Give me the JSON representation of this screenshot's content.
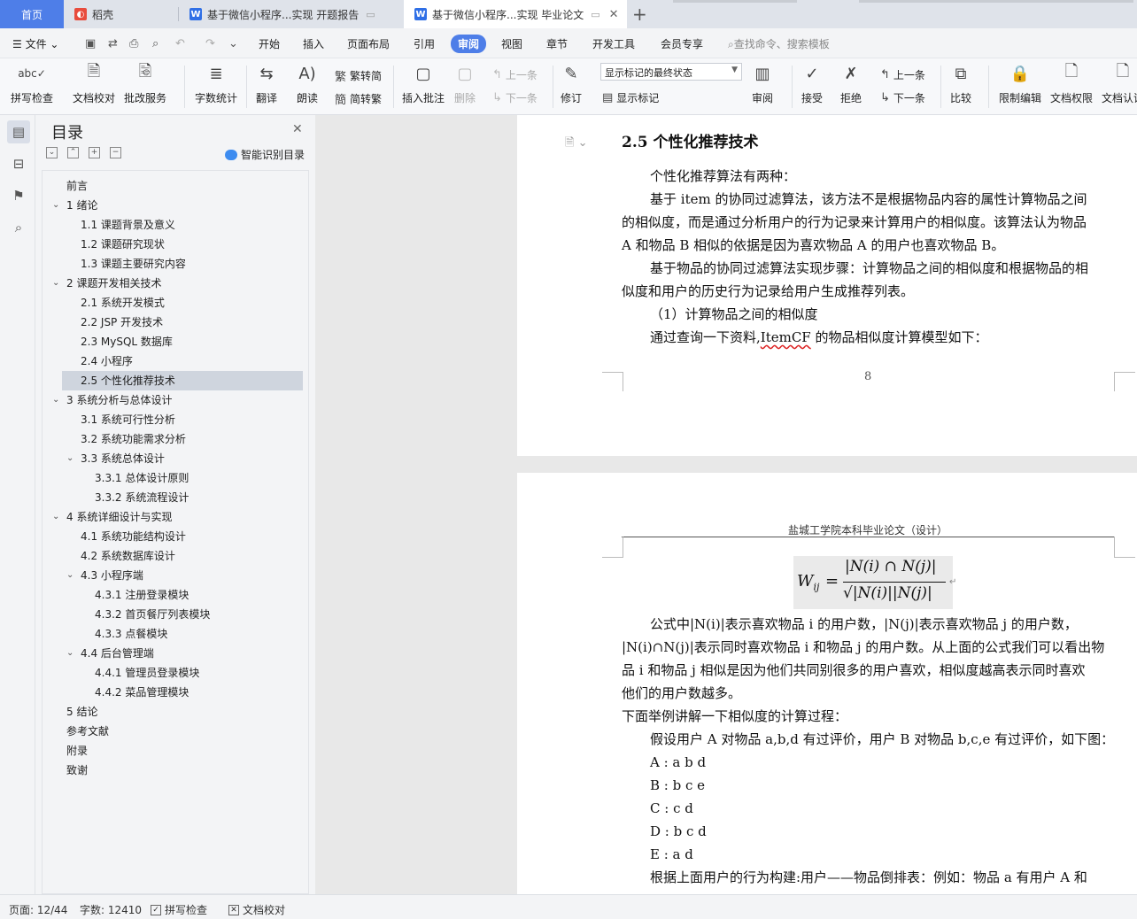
{
  "tabs": {
    "home": "首页",
    "daoke": "稻壳",
    "doc1": "基于微信小程序...实现 开题报告",
    "doc2": "基于微信小程序...实现 毕业论文"
  },
  "menu": {
    "file": "文件",
    "items": [
      "开始",
      "插入",
      "页面布局",
      "引用",
      "审阅",
      "视图",
      "章节",
      "开发工具",
      "会员专享"
    ],
    "search_placeholder": "查找命令、搜索模板"
  },
  "ribbon": {
    "spell_check": "拼写检查",
    "doc_proof": "文档校对",
    "batch_service": "批改服务",
    "word_count": "字数统计",
    "translate": "翻译",
    "read_aloud": "朗读",
    "trad_convert": "繁转简",
    "simp_convert": "简转繁",
    "insert_comment": "插入批注",
    "delete": "删除",
    "prev_comment": "上一条",
    "next_comment": "下一条",
    "revise": "修订",
    "markup_state": "显示标记的最终状态",
    "show_markup": "显示标记",
    "review": "审阅",
    "accept": "接受",
    "reject": "拒绝",
    "prev_change": "上一条",
    "next_change": "下一条",
    "compare": "比较",
    "restrict_edit": "限制编辑",
    "doc_permission": "文档权限",
    "doc_cert": "文档认证"
  },
  "toc": {
    "title": "目录",
    "smart": "智能识别目录",
    "items": [
      "前言",
      "1 绪论",
      "1.1 课题背景及意义",
      "1.2 课题研究现状",
      "1.3 课题主要研究内容",
      "2 课题开发相关技术",
      "2.1 系统开发模式",
      "2.2 JSP 开发技术",
      "2.3 MySQL 数据库",
      "2.4 小程序",
      "2.5 个性化推荐技术",
      "3 系统分析与总体设计",
      "3.1 系统可行性分析",
      "3.2 系统功能需求分析",
      "3.3 系统总体设计",
      "3.3.1 总体设计原则",
      "3.3.2 系统流程设计",
      "4 系统详细设计与实现",
      "4.1 系统功能结构设计",
      "4.2 系统数据库设计",
      "4.3 小程序端",
      "4.3.1 注册登录模块",
      "4.3.2 首页餐厅列表模块",
      "4.3.3 点餐模块",
      "4.4 后台管理端",
      "4.4.1 管理员登录模块",
      "4.4.2 菜品管理模块",
      "5 结论",
      "参考文献",
      "附录",
      "致谢"
    ],
    "selected": "2.5 个性化推荐技术"
  },
  "page1": {
    "heading": "2.5  个性化推荐技术",
    "lines": [
      "个性化推荐算法有两种：",
      "基于 item 的协同过滤算法，该方法不是根据物品内容的属性计算物品之间",
      "的相似度，而是通过分析用户的行为记录来计算用户的相似度。该算法认为物品",
      "A 和物品 B 相似的依据是因为喜欢物品 A 的用户也喜欢物品 B。",
      "基于物品的协同过滤算法实现步骤：计算物品之间的相似度和根据物品的相",
      "似度和用户的历史行为记录给用户生成推荐列表。",
      "（1）计算物品之间的相似度",
      "通过查询一下资料,",
      "ItemCF",
      " 的物品相似度计算模型如下："
    ],
    "page_number": "8"
  },
  "page2": {
    "header": "盐城工学院本科毕业论文（设计）",
    "formula": {
      "lhs": "W",
      "sub": "ij",
      "numerator": "|N(i) ∩ N(j)|",
      "denominator": "√|N(i)||N(j)|"
    },
    "lines": [
      "公式中|N(i)|表示喜欢物品 i 的用户数，|N(j)|表示喜欢物品 j 的用户数，",
      "|N(i)∩N(j)|表示同时喜欢物品 i 和物品 j 的用户数。从上面的公式我们可以看出物",
      "品 i 和物品 j 相似是因为他们共同别很多的用户喜欢，相似度越高表示同时喜欢",
      "他们的用户数越多。",
      "下面举例讲解一下相似度的计算过程：",
      "假设用户 A 对物品 a,b,d 有过评价，用户 B 对物品 b,c,e 有过评价，如下图：",
      "A : a b d",
      "B : b c e",
      "C : c d",
      "D : b c d",
      "E : a d",
      "根据上面用户的行为构建:用户——物品倒排表：例如：物品 a 有用户 A 和"
    ]
  },
  "status": {
    "page": "页面: 12/44",
    "words": "字数: 12410",
    "spell": "拼写检查",
    "proof": "文档校对"
  }
}
